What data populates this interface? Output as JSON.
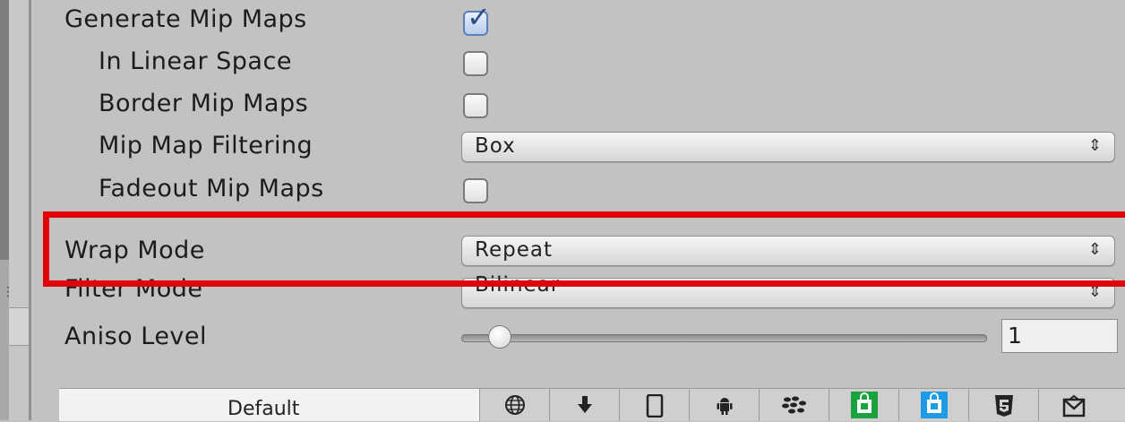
{
  "settings": {
    "generate_mip_maps": {
      "label": "Generate Mip Maps",
      "checked": true
    },
    "in_linear_space": {
      "label": "In Linear Space",
      "checked": false
    },
    "border_mip_maps": {
      "label": "Border Mip Maps",
      "checked": false
    },
    "mip_map_filtering": {
      "label": "Mip Map Filtering",
      "value": "Box"
    },
    "fadeout_mip_maps": {
      "label": "Fadeout Mip Maps",
      "checked": false
    },
    "wrap_mode": {
      "label": "Wrap Mode",
      "value": "Repeat"
    },
    "filter_mode": {
      "label": "Filter Mode",
      "value": "Bilinear"
    },
    "aniso_level": {
      "label": "Aniso Level",
      "value": "1"
    }
  },
  "platforms": {
    "default_label": "Default",
    "tabs": [
      "globe-icon",
      "download-icon",
      "phone-icon",
      "android-icon",
      "blackberry-icon",
      "windows-store-icon",
      "windows-phone-icon",
      "html5-icon",
      "webgl-icon"
    ]
  },
  "colors": {
    "highlight": "#e0040a",
    "checkbox_checked": "#5b7fb8"
  }
}
